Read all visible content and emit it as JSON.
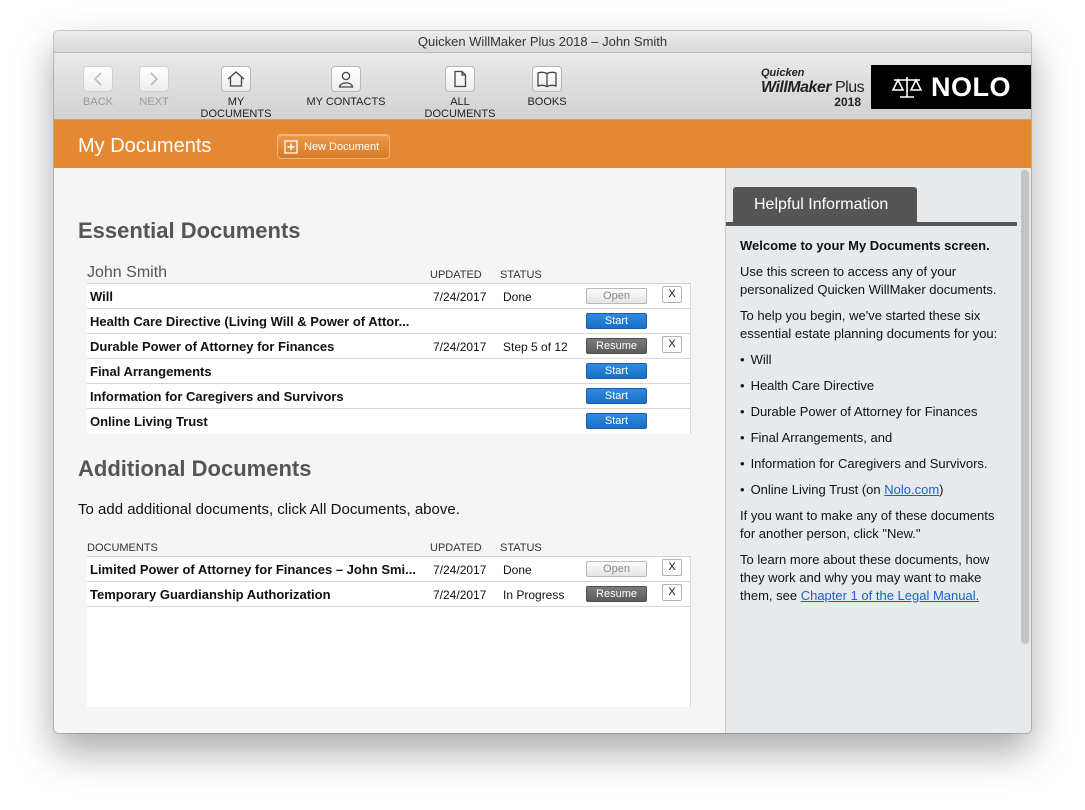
{
  "window": {
    "title": "Quicken WillMaker Plus 2018 – John Smith"
  },
  "toolbar": {
    "back": "BACK",
    "next": "NEXT",
    "my_documents": "MY DOCUMENTS",
    "my_contacts": "MY CONTACTS",
    "all_documents": "ALL DOCUMENTS",
    "books": "BOOKS"
  },
  "brand": {
    "quicken": "Quicken",
    "willmaker": "WillMaker",
    "plus": "Plus",
    "year": "2018",
    "nolo": "NOLO"
  },
  "header": {
    "title": "My Documents",
    "new_document": "New Document"
  },
  "essential": {
    "heading": "Essential Documents",
    "person": "John Smith",
    "col_updated": "UPDATED",
    "col_status": "STATUS",
    "rows": [
      {
        "name": "Will",
        "updated": "7/24/2017",
        "status": "Done",
        "action": "Open",
        "x": "X"
      },
      {
        "name": "Health Care Directive (Living Will & Power of Attor...",
        "updated": "",
        "status": "",
        "action": "Start",
        "x": ""
      },
      {
        "name": "Durable Power of Attorney for Finances",
        "updated": "7/24/2017",
        "status": "Step 5 of 12",
        "action": "Resume",
        "x": "X"
      },
      {
        "name": "Final Arrangements",
        "updated": "",
        "status": "",
        "action": "Start",
        "x": ""
      },
      {
        "name": "Information for Caregivers and Survivors",
        "updated": "",
        "status": "",
        "action": "Start",
        "x": ""
      },
      {
        "name": "Online Living Trust",
        "updated": "",
        "status": "",
        "action": "Start",
        "x": ""
      }
    ]
  },
  "additional": {
    "heading": "Additional Documents",
    "instructions": "To add additional documents, click All Documents, above.",
    "col_documents": "DOCUMENTS",
    "col_updated": "UPDATED",
    "col_status": "STATUS",
    "rows": [
      {
        "name": "Limited Power of Attorney for Finances – John Smi...",
        "updated": "7/24/2017",
        "status": "Done",
        "action": "Open",
        "x": "X"
      },
      {
        "name": "Temporary Guardianship Authorization",
        "updated": "7/24/2017",
        "status": "In Progress",
        "action": "Resume",
        "x": "X"
      }
    ]
  },
  "helpful": {
    "tab": "Helpful Information",
    "welcome": "Welcome to your My Documents screen.",
    "p1": "Use this screen to access any of your personalized Quicken WillMaker documents.",
    "p2": "To help you begin, we've started these six essential estate planning documents for you:",
    "bullets": [
      "Will",
      "Health Care Directive",
      "Durable Power of Attorney for Finances",
      "Final Arrangements, and",
      "Information for Caregivers and Survivors."
    ],
    "bullet_trust_prefix": "Online Living Trust (on ",
    "bullet_trust_link": "Nolo.com",
    "bullet_trust_suffix": ")",
    "p3": "If you want to make any of these documents for another person, click \"New.\"",
    "p4_prefix": "To learn more about these documents, how they work and why you may want to make them, see ",
    "p4_link": "Chapter 1 of the Legal Manual."
  }
}
